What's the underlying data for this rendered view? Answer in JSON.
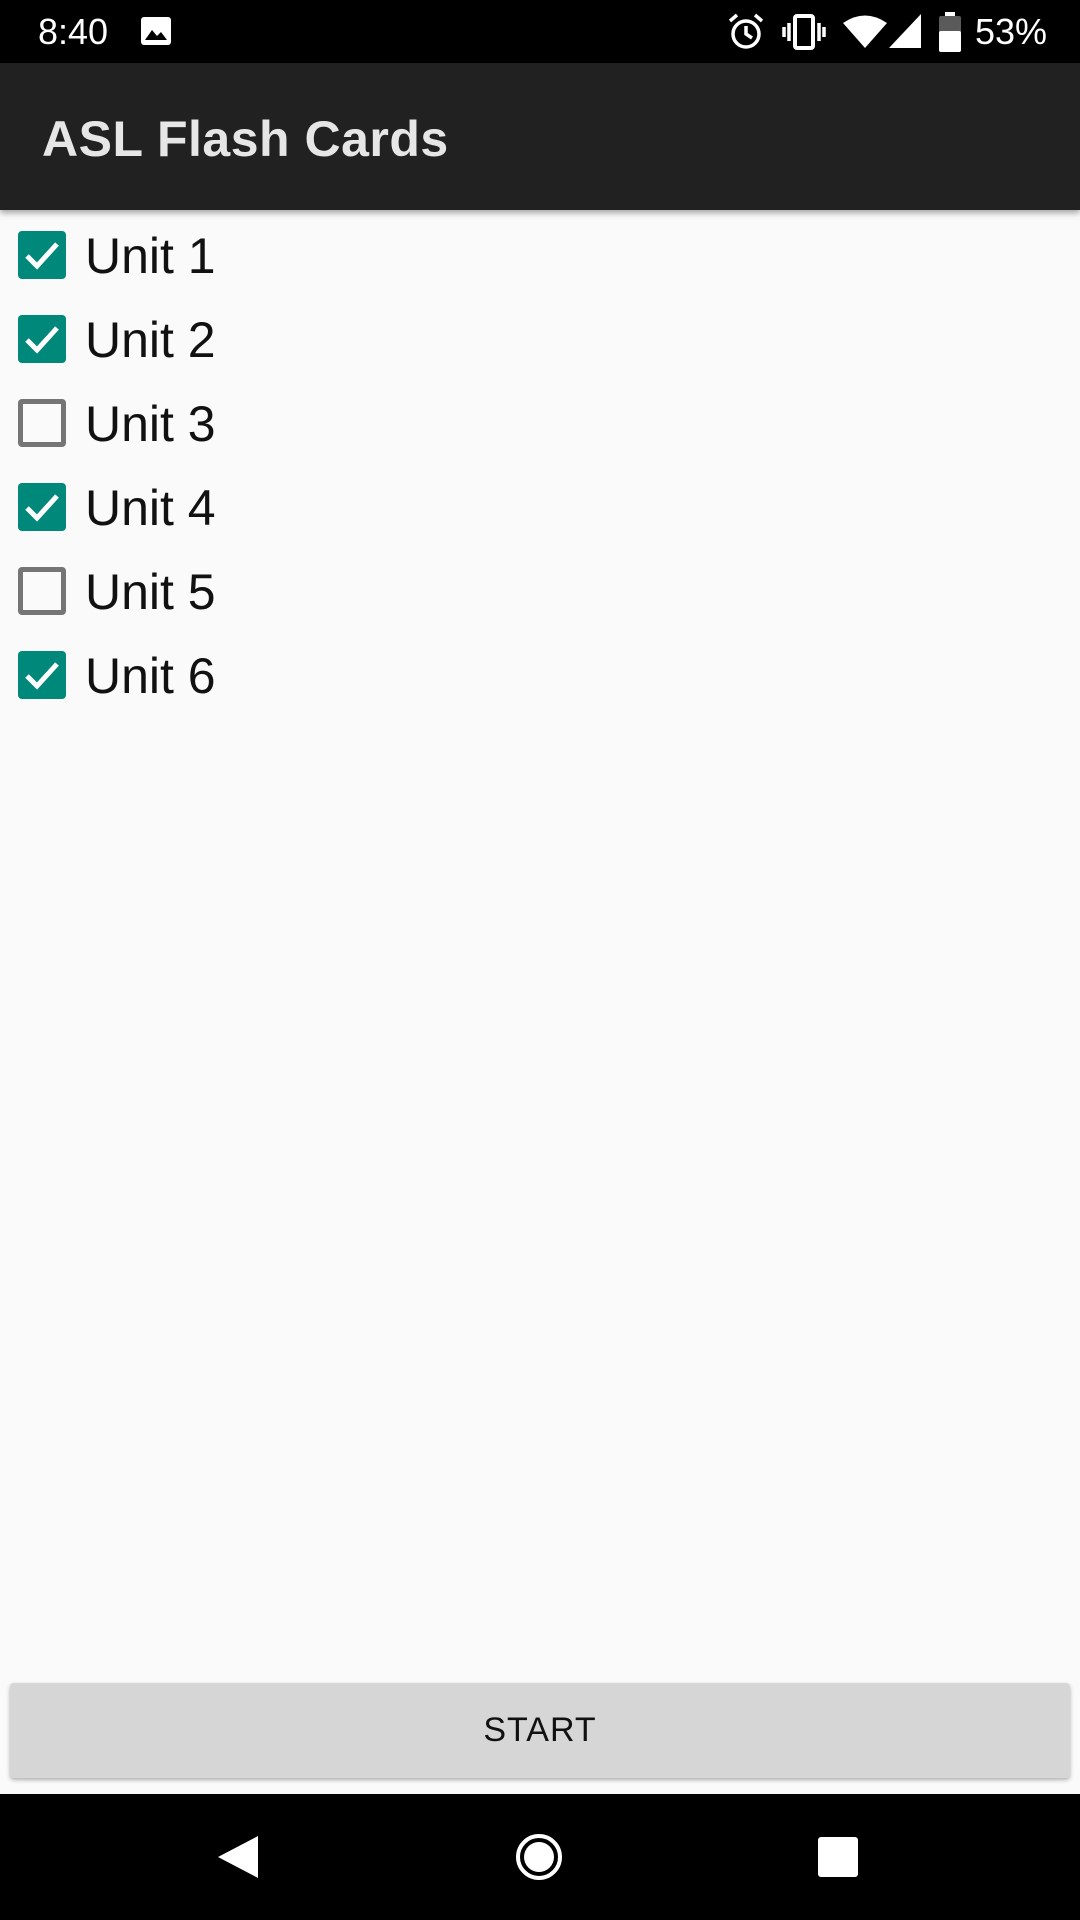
{
  "status_bar": {
    "time": "8:40",
    "battery_percent": "53%",
    "icons": [
      "image-icon",
      "alarm-icon",
      "vibrate-icon",
      "wifi-icon",
      "signal-icon",
      "battery-icon"
    ]
  },
  "app_bar": {
    "title": "ASL Flash Cards"
  },
  "units": [
    {
      "label": "Unit 1",
      "checked": true
    },
    {
      "label": "Unit 2",
      "checked": true
    },
    {
      "label": "Unit 3",
      "checked": false
    },
    {
      "label": "Unit 4",
      "checked": true
    },
    {
      "label": "Unit 5",
      "checked": false
    },
    {
      "label": "Unit 6",
      "checked": true
    }
  ],
  "start_button": {
    "label": "START"
  },
  "nav_bar": {
    "icons": [
      "back-icon",
      "home-icon",
      "recents-icon"
    ]
  },
  "colors": {
    "accent": "#00897b",
    "app_bar": "#212121",
    "background": "#fafafa",
    "button": "#d6d6d6"
  }
}
